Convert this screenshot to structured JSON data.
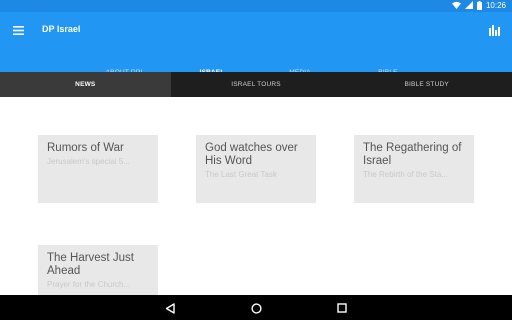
{
  "status_bar": {
    "time": "10:26"
  },
  "app": {
    "title": "DP Israel"
  },
  "tabs": [
    {
      "label": "ABOUT DPI",
      "active": false
    },
    {
      "label": "ISRAEL",
      "active": true
    },
    {
      "label": "MEDIA",
      "active": false
    },
    {
      "label": "BIBLE",
      "active": false
    }
  ],
  "subtabs": [
    {
      "label": "NEWS",
      "active": true
    },
    {
      "label": "ISRAEL TOURS",
      "active": false
    },
    {
      "label": "BIBLE STUDY",
      "active": false
    }
  ],
  "cards": [
    {
      "title": "Rumors of War",
      "subtitle": "Jerusalem's special 5..."
    },
    {
      "title": "God watches over His Word",
      "subtitle": "The Last Great Task"
    },
    {
      "title": "The Regathering of Israel",
      "subtitle": "The Rebirth of the Sta..."
    },
    {
      "title": "The Harvest Just Ahead",
      "subtitle": "Prayer for the Church..."
    }
  ],
  "colors": {
    "primary": "#2196f3",
    "status_bar": "#1e88e5",
    "subtab_bar": "#1e1e1e",
    "card_bg": "#e8e8e8"
  },
  "icons": {
    "menu": "menu-icon",
    "chart": "bar-chart-icon",
    "back": "back-icon",
    "home": "home-icon",
    "recents": "recents-icon",
    "wifi": "wifi-icon",
    "signal": "signal-icon",
    "battery": "battery-icon"
  }
}
